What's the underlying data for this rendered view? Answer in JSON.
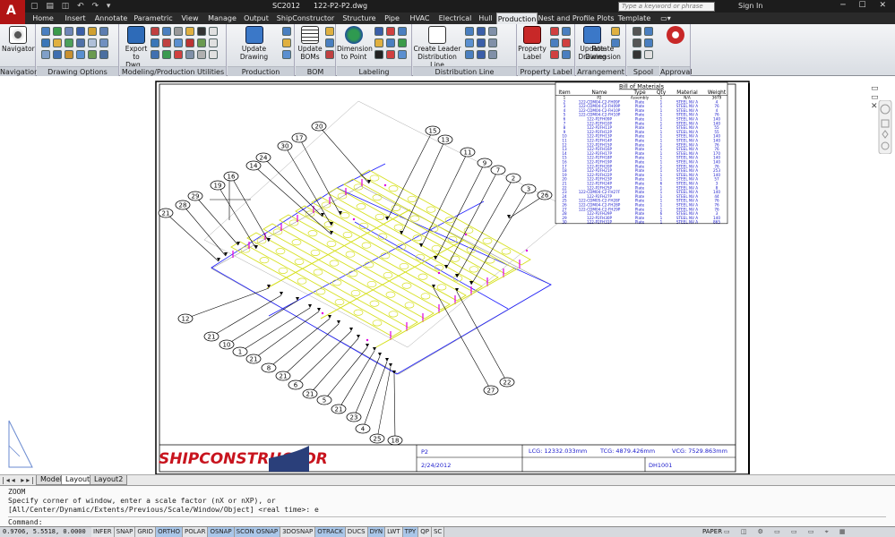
{
  "window": {
    "workspace": "SC2012",
    "filename": "122-P2-P2.dwg",
    "search_placeholder": "Type a keyword or phrase",
    "sign_in": "Sign In",
    "app_letter": "A"
  },
  "ribbon_tabs": [
    "Home",
    "Insert",
    "Annotate",
    "Parametric",
    "View",
    "Manage",
    "Output",
    "ShipConstructor",
    "Structure",
    "Pipe",
    "HVAC",
    "Electrical",
    "Hull",
    "Production",
    "Nest and Profile Plots",
    "Template"
  ],
  "active_tab": "Production",
  "panels": {
    "navigation": {
      "title": "Navigation",
      "navigator": "Navigator"
    },
    "drawing_options": {
      "title": "Drawing Options"
    },
    "modeling": {
      "title": "Modeling/Production Utilities",
      "export": "Export to Dwg..."
    },
    "production_utilities": {
      "title": "Production Utilities",
      "update_drawing": "Update Drawing"
    },
    "bom": {
      "title": "BOM",
      "update_boms": "Update BOMs"
    },
    "labeling": {
      "title": "Labeling",
      "dimension": "Dimension to Point"
    },
    "distribution": {
      "title": "Distribution Line",
      "create_leader": "Create Leader Distribution Line"
    },
    "property_label": {
      "title": "Property Label",
      "label": "Property Label"
    },
    "arrangement": {
      "title": "Arrangement",
      "update": "Update Drawing"
    },
    "spool": {
      "title": "Spool",
      "rotate": "Rotate Dimension"
    },
    "approval": {
      "title": "Approval"
    }
  },
  "bom": {
    "title": "Bill of Materials",
    "headers": [
      "Item",
      "Name",
      "Type",
      "Qty",
      "Material",
      "Weight"
    ],
    "rows": [
      [
        "1",
        "P2",
        "Assembly",
        "1",
        "N/A",
        "3679"
      ],
      [
        "2",
        "122-CDM04-C2-FH09F",
        "Plate",
        "1",
        "STEEL NV A",
        "4"
      ],
      [
        "3",
        "122-CDM04-C2-FH09P",
        "Plate",
        "1",
        "STEEL NV A",
        "76"
      ],
      [
        "4",
        "122-CDM04-C2-FH10P",
        "Plate",
        "1",
        "STEEL NV A",
        "4"
      ],
      [
        "5",
        "122-CDM04-C2-FH10P",
        "Plate",
        "1",
        "STEEL NV A",
        "76"
      ],
      [
        "6",
        "122-P2FH09P",
        "Plate",
        "1",
        "STEEL NV A",
        "140"
      ],
      [
        "7",
        "122-P2FH10P",
        "Plate",
        "1",
        "STEEL NV A",
        "140"
      ],
      [
        "8",
        "122-P2FH11P",
        "Plate",
        "1",
        "STEEL NV A",
        "55"
      ],
      [
        "9",
        "122-P2FH12P",
        "Plate",
        "1",
        "STEEL NV A",
        "55"
      ],
      [
        "10",
        "122-P2FH13P",
        "Plate",
        "1",
        "STEEL NV A",
        "140"
      ],
      [
        "11",
        "122-P2FH14P",
        "Plate",
        "1",
        "STEEL NV A",
        "140"
      ],
      [
        "12",
        "122-P2FH15P",
        "Plate",
        "1",
        "STEEL NV A",
        "76"
      ],
      [
        "13",
        "122-P2FH16P",
        "Plate",
        "1",
        "STEEL NV A",
        "76"
      ],
      [
        "14",
        "122-P2FH17P",
        "Plate",
        "1",
        "STEEL NV A",
        "170"
      ],
      [
        "15",
        "122-P2FH18P",
        "Plate",
        "1",
        "STEEL NV A",
        "140"
      ],
      [
        "16",
        "122-P2FH19P",
        "Plate",
        "1",
        "STEEL NV A",
        "140"
      ],
      [
        "17",
        "122-P2FH20P",
        "Plate",
        "1",
        "STEEL NV A",
        "76"
      ],
      [
        "18",
        "122-P2FH21P",
        "Plate",
        "1",
        "STEEL NV A",
        "253"
      ],
      [
        "19",
        "122-P2FH22P",
        "Plate",
        "1",
        "STEEL NV A",
        "140"
      ],
      [
        "20",
        "122-P2FH23P",
        "Plate",
        "1",
        "STEEL NV A",
        "57"
      ],
      [
        "21",
        "122-P2FH24P",
        "Plate",
        "6",
        "STEEL NV A",
        "3"
      ],
      [
        "22",
        "122-P2FH25P",
        "Plate",
        "1",
        "STEEL NV A",
        "8"
      ],
      [
        "23",
        "122-CDM04-C2-FH27F",
        "Plate",
        "1",
        "STEEL NV A",
        "140"
      ],
      [
        "24",
        "122-P2FH27P",
        "Plate",
        "1",
        "STEEL NV A",
        "44"
      ],
      [
        "25",
        "122-CDM05-C2-FH28F",
        "Plate",
        "1",
        "STEEL NV A",
        "76"
      ],
      [
        "26",
        "122-CDM04-C2-FH28P",
        "Plate",
        "1",
        "STEEL NV A",
        "76"
      ],
      [
        "27",
        "122-CDM04-C2-FH29P",
        "Plate",
        "1",
        "STEEL NV A",
        "76"
      ],
      [
        "28",
        "122-P2FH29P",
        "Plate",
        "6",
        "STEEL NV A",
        "3"
      ],
      [
        "29",
        "122-P2FH30P",
        "Plate",
        "1",
        "STEEL NV A",
        "140"
      ],
      [
        "30",
        "122-P2FH31P",
        "Plate",
        "1",
        "STEEL NV A",
        "865"
      ]
    ]
  },
  "title_block": {
    "logo": "SHIPCONSTRUCTOR",
    "drawing": "P2",
    "date": "2/24/2012",
    "lcg": "LCG: 12332.033mm",
    "tcg": "TCG: 4879.426mm",
    "vcg": "VCG: 7529.863mm",
    "number": "DH1001"
  },
  "balloons": [
    "20",
    "15",
    "13",
    "17",
    "30",
    "24",
    "14",
    "11",
    "9",
    "7",
    "2",
    "3",
    "26",
    "16",
    "19",
    "29",
    "28",
    "21",
    "12",
    "21",
    "10",
    "1",
    "21",
    "8",
    "21",
    "6",
    "21",
    "5",
    "21",
    "23",
    "4",
    "25",
    "18",
    "27",
    "22"
  ],
  "layout_tabs": [
    "Model",
    "Layout1",
    "Layout2"
  ],
  "active_layout": "Layout1",
  "command": {
    "history": [
      "ZOOM",
      "Specify corner of window, enter a scale factor (nX or nXP), or",
      "[All/Center/Dynamic/Extents/Previous/Scale/Window/Object] <real time>: e"
    ],
    "prompt": "Command:"
  },
  "status": {
    "coords": "0.9706, 5.5518, 0.0000",
    "toggles": [
      "INFER",
      "SNAP",
      "GRID",
      "ORTHO",
      "POLAR",
      "OSNAP",
      "SCON OSNAP",
      "3DOSNAP",
      "OTRACK",
      "DUCS",
      "DYN",
      "LWT",
      "TPY",
      "QP",
      "SC"
    ],
    "toggles_on": [
      "ORTHO",
      "OSNAP",
      "SCON OSNAP",
      "OTRACK",
      "DYN",
      "TPY"
    ],
    "paper": "PAPER"
  },
  "colors": {
    "plate_yellow": "#d6e01e",
    "outline_blue": "#1a1aff",
    "accent_magenta": "#e000e0",
    "logo_red": "#c8141e",
    "active_tab_bg": "#e7e9ec"
  }
}
